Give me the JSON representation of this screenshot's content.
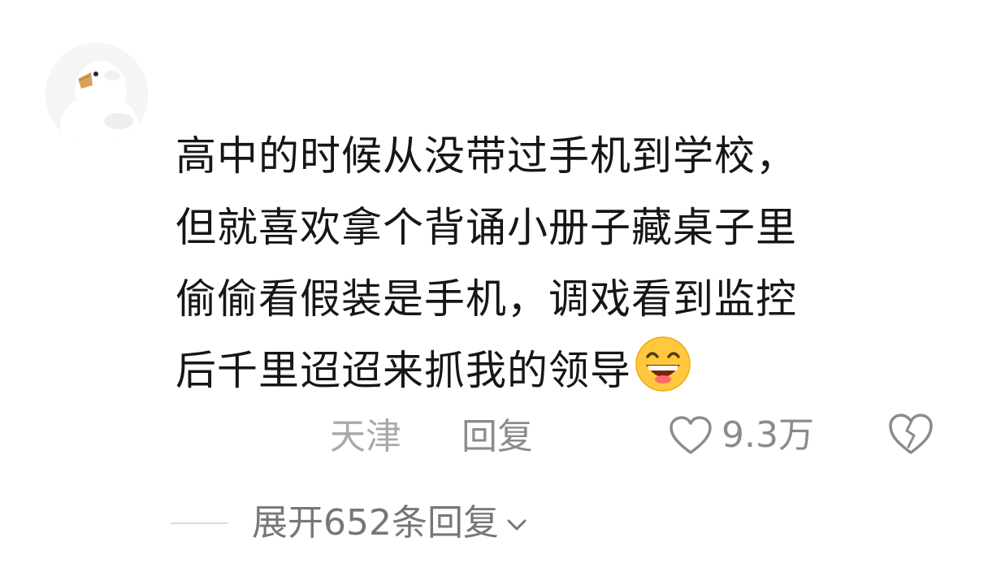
{
  "comment": {
    "avatar_icon": "duck-avatar",
    "lines": [
      "高中的时候从没带过手机到学校，",
      "但就喜欢拿个背诵小册子藏桌子里",
      "偷偷看假装是手机，调戏看到监控",
      "后千里迢迢来抓我的领导"
    ],
    "emoji_icon": "grinning-face-emoji",
    "location": "天津",
    "reply_label": "回复",
    "like_icon": "heart-outline-icon",
    "like_count": "9.3万",
    "dislike_icon": "broken-heart-icon"
  },
  "replies": {
    "expand_label": "展开652条回复",
    "expand_icon": "chevron-down-icon"
  },
  "colors": {
    "text_primary": "#161616",
    "text_secondary": "#8b8b8b",
    "location": "#a9a9a9",
    "expand_text": "#777777",
    "emoji_face": "#ffc83d"
  }
}
